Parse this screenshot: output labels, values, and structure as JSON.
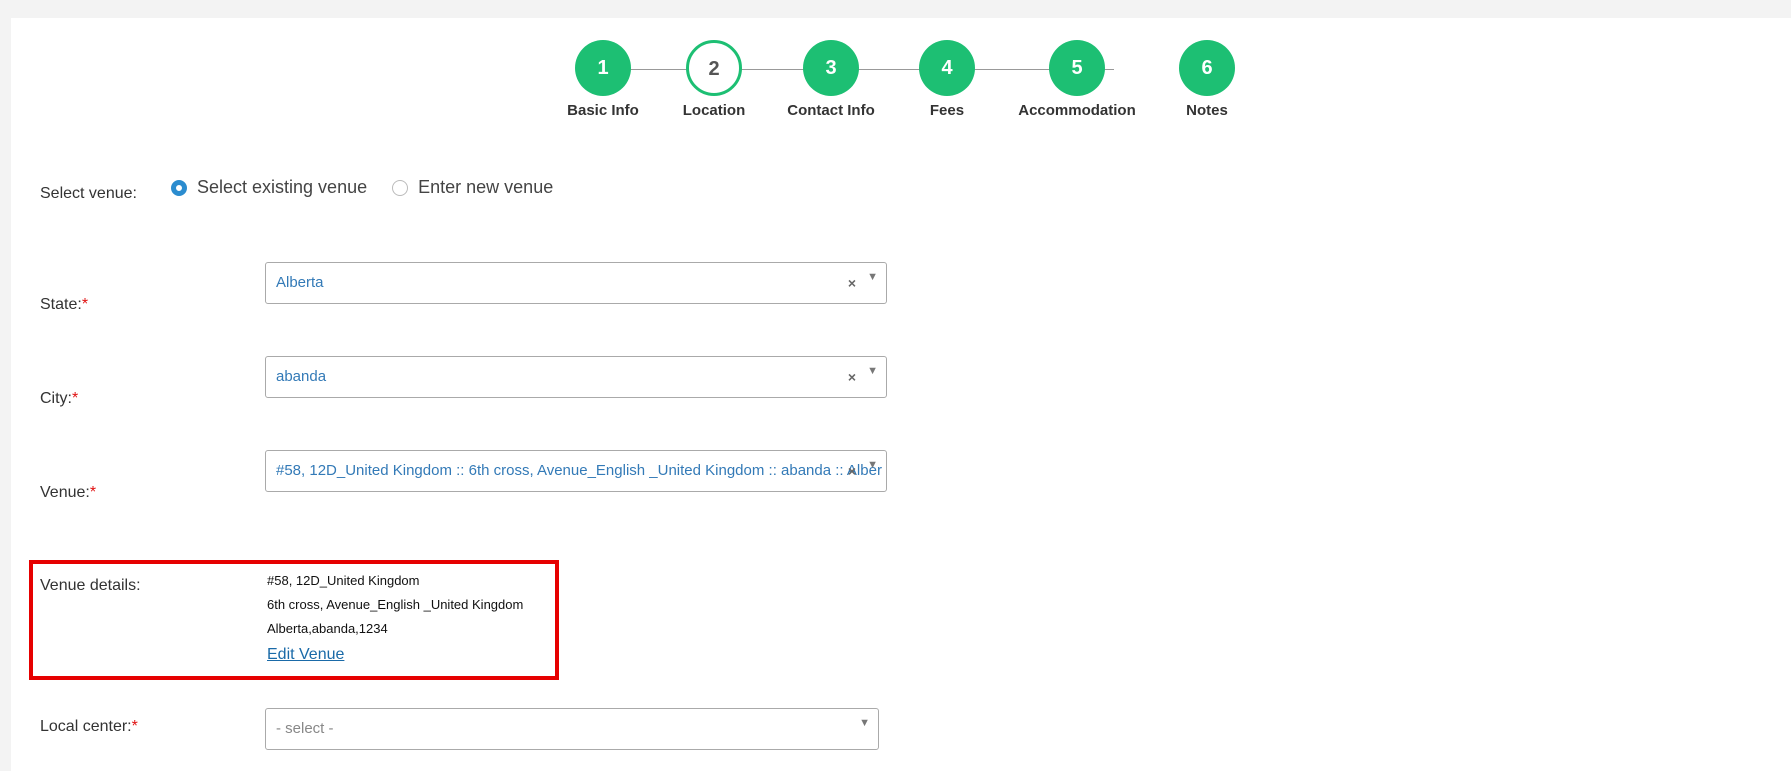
{
  "stepper": {
    "steps": [
      {
        "number": "1",
        "label": "Basic Info",
        "state": "done"
      },
      {
        "number": "2",
        "label": "Location",
        "state": "current"
      },
      {
        "number": "3",
        "label": "Contact Info",
        "state": "done"
      },
      {
        "number": "4",
        "label": "Fees",
        "state": "done"
      },
      {
        "number": "5",
        "label": "Accommodation",
        "state": "done"
      },
      {
        "number": "6",
        "label": "Notes",
        "state": "done"
      }
    ]
  },
  "venue_choice": {
    "label": "Select venue:",
    "options": [
      {
        "label": "Select existing venue",
        "checked": true
      },
      {
        "label": "Enter new venue",
        "checked": false
      }
    ]
  },
  "state_field": {
    "label": "State:",
    "required_mark": "*",
    "value": "Alberta",
    "clear_icon": "clear-x-icon",
    "arrow_icon": "dropdown-arrow-icon"
  },
  "city_field": {
    "label": "City:",
    "required_mark": "*",
    "value": "abanda"
  },
  "venue_field": {
    "label": "Venue:",
    "required_mark": "*",
    "value": "#58, 12D_United Kingdom :: 6th cross, Avenue_English _United Kingdom :: abanda :: Alber"
  },
  "venue_details": {
    "label": "Venue details:",
    "line1": "#58, 12D_United Kingdom",
    "line2": "6th cross, Avenue_English _United Kingdom",
    "line3": "Alberta,abanda,1234",
    "edit_link": "Edit Venue"
  },
  "local_center_field": {
    "label": "Local center:",
    "required_mark": "*",
    "placeholder": "- select -"
  },
  "colors": {
    "step_green": "#1dbf73",
    "link_blue": "#337ab7",
    "required_red": "#e01010",
    "highlight_red": "#e60000"
  }
}
